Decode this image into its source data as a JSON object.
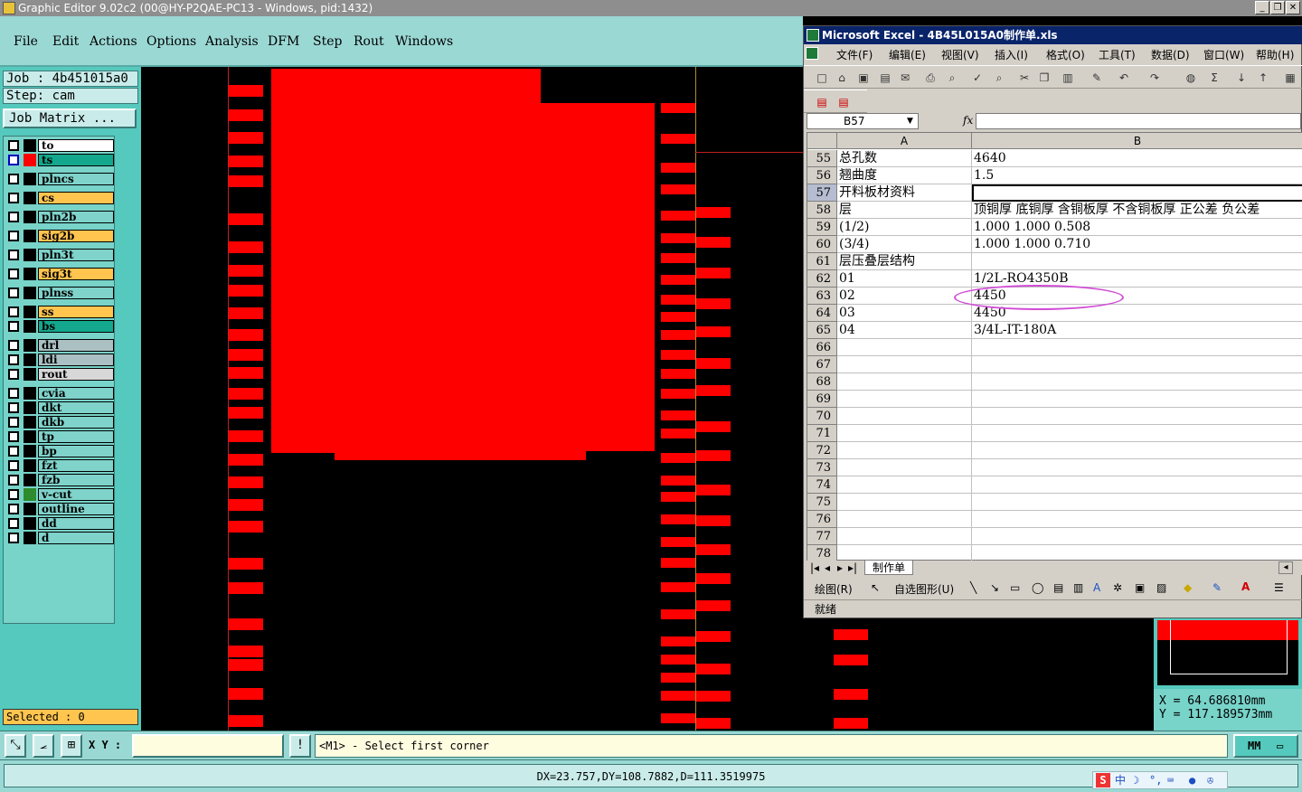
{
  "titlebar": {
    "title": "Graphic Editor 9.02c2 (00@HY-P2QAE-PC13 - Windows, pid:1432)"
  },
  "menu": [
    "File",
    "Edit",
    "Actions",
    "Options",
    "Analysis",
    "DFM",
    "Step",
    "Rout",
    "Windows"
  ],
  "job": {
    "job_label": "Job : 4b451015a0",
    "step_label": "Step: cam",
    "matrix_button": "Job Matrix ..."
  },
  "layers": [
    {
      "name": "to",
      "color": "#ffffff"
    },
    {
      "name": "ts",
      "color": "#13a88d"
    },
    {
      "name": "plncs",
      "color": "#7fd3cb"
    },
    {
      "name": "cs",
      "color": "#ffc54f"
    },
    {
      "name": "pln2b",
      "color": "#7fd3cb"
    },
    {
      "name": "sig2b",
      "color": "#ffc54f"
    },
    {
      "name": "pln3t",
      "color": "#7fd3cb"
    },
    {
      "name": "sig3t",
      "color": "#ffc54f"
    },
    {
      "name": "plnss",
      "color": "#7fd3cb"
    },
    {
      "name": "ss",
      "color": "#ffc54f"
    },
    {
      "name": "bs",
      "color": "#13a88d"
    },
    {
      "name": "drl",
      "color": "#aac0c3"
    },
    {
      "name": "ldi",
      "color": "#aac0c3"
    },
    {
      "name": "rout",
      "color": "#d8d8d8"
    },
    {
      "name": "cvia",
      "color": "#7fd3cb"
    },
    {
      "name": "dkt",
      "color": "#7fd3cb"
    },
    {
      "name": "dkb",
      "color": "#7fd3cb"
    },
    {
      "name": "tp",
      "color": "#7fd3cb"
    },
    {
      "name": "bp",
      "color": "#7fd3cb"
    },
    {
      "name": "fzt",
      "color": "#7fd3cb"
    },
    {
      "name": "fzb",
      "color": "#7fd3cb"
    },
    {
      "name": "v-cut",
      "color": "#7fd3cb"
    },
    {
      "name": "outline",
      "color": "#7fd3cb"
    },
    {
      "name": "dd",
      "color": "#7fd3cb"
    },
    {
      "name": "d",
      "color": "#7fd3cb"
    }
  ],
  "selected": "Selected : 0",
  "excel": {
    "title": "Microsoft Excel - 4B45L015A0制作单.xls",
    "menu": [
      "文件(F)",
      "编辑(E)",
      "视图(V)",
      "插入(I)",
      "格式(O)",
      "工具(T)",
      "数据(D)",
      "窗口(W)",
      "帮助(H)"
    ],
    "namebox": "B57",
    "fx": "fx",
    "col_a": "A",
    "col_b": "B",
    "rows": [
      {
        "n": "55",
        "a": "总孔数",
        "b": "4640"
      },
      {
        "n": "56",
        "a": "翘曲度",
        "b": "1.5"
      },
      {
        "n": "57",
        "a": "开料板材资料",
        "b": ""
      },
      {
        "n": "58",
        "a": "层",
        "b": "顶铜厚 底铜厚 含铜板厚 不含铜板厚 正公差 负公差"
      },
      {
        "n": "59",
        "a": "(1/2)",
        "b": "1.000  1.000          0.508"
      },
      {
        "n": "60",
        "a": "(3/4)",
        "b": "1.000  1.000          0.710"
      },
      {
        "n": "61",
        "a": "层压叠层结构",
        "b": ""
      },
      {
        "n": "62",
        "a": "01",
        "b": "1/2L-RO4350B"
      },
      {
        "n": "63",
        "a": "02",
        "b": "4450"
      },
      {
        "n": "64",
        "a": "03",
        "b": "4450"
      },
      {
        "n": "65",
        "a": "04",
        "b": "3/4L-IT-180A"
      },
      {
        "n": "66",
        "a": "",
        "b": ""
      },
      {
        "n": "67",
        "a": "",
        "b": ""
      },
      {
        "n": "68",
        "a": "",
        "b": ""
      },
      {
        "n": "69",
        "a": "",
        "b": ""
      },
      {
        "n": "70",
        "a": "",
        "b": ""
      },
      {
        "n": "71",
        "a": "",
        "b": ""
      },
      {
        "n": "72",
        "a": "",
        "b": ""
      },
      {
        "n": "73",
        "a": "",
        "b": ""
      },
      {
        "n": "74",
        "a": "",
        "b": ""
      },
      {
        "n": "75",
        "a": "",
        "b": ""
      },
      {
        "n": "76",
        "a": "",
        "b": ""
      },
      {
        "n": "77",
        "a": "",
        "b": ""
      },
      {
        "n": "78",
        "a": "",
        "b": ""
      }
    ],
    "sheet_tab": "制作单",
    "draw_label": "绘图(R)",
    "autoshape_label": "自选图形(U)",
    "status": "就绪"
  },
  "coords": {
    "x": "X  =  64.686810mm",
    "y": "Y  =  117.189573mm"
  },
  "bottom": {
    "xy_label": "X Y :",
    "xy_value": "",
    "prompt": "<M1> - Select first corner",
    "units": "MM"
  },
  "measure": "DX=23.757,DY=108.7882,D=111.3519975"
}
